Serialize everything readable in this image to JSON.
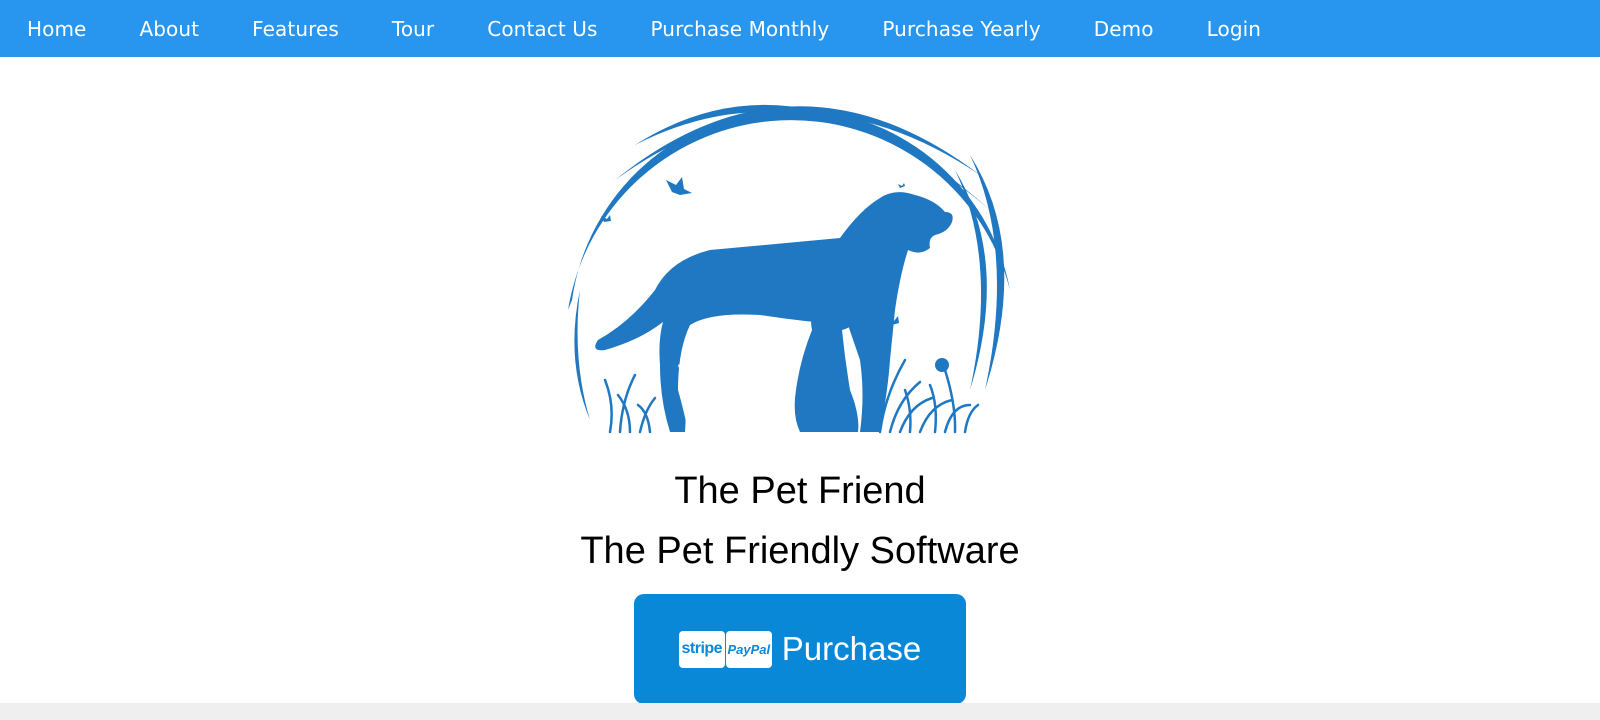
{
  "nav": {
    "items": [
      {
        "label": "Home"
      },
      {
        "label": "About"
      },
      {
        "label": "Features"
      },
      {
        "label": "Tour"
      },
      {
        "label": "Contact Us"
      },
      {
        "label": "Purchase Monthly"
      },
      {
        "label": "Purchase Yearly"
      },
      {
        "label": "Demo"
      },
      {
        "label": "Login"
      }
    ]
  },
  "hero": {
    "logo_icon": "dog-and-cat-silhouette-logo",
    "title": "The Pet Friend",
    "subtitle": "The Pet Friendly Software"
  },
  "purchase": {
    "stripe_label": "stripe",
    "paypal_label": "PayPal",
    "label": "Purchase"
  },
  "colors": {
    "nav_bg": "#2896ef",
    "logo": "#1f78c1",
    "button_bg": "#0a88d8",
    "footer_band": "#efefef"
  }
}
